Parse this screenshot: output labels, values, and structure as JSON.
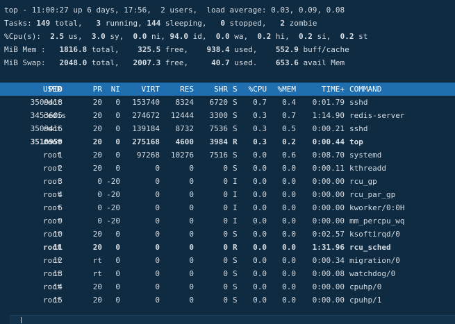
{
  "summary": {
    "uptime_line": "top - 11:00:27 up 6 days, 17:56,  2 users,  load average: 0.03, 0.09, 0.08",
    "tasks": {
      "label": "Tasks:",
      "total": "149",
      "total_label": " total,   ",
      "running": "3",
      "running_label": " running, ",
      "sleeping": "144",
      "sleeping_label": " sleeping,   ",
      "stopped": "0",
      "stopped_label": " stopped,   ",
      "zombie": "2",
      "zombie_label": " zombie"
    },
    "cpu": {
      "label": "%Cpu(s):  ",
      "us": "2.5",
      "us_label": " us,  ",
      "sy": "3.0",
      "sy_label": " sy,  ",
      "ni": "0.0",
      "ni_label": " ni, ",
      "id": "94.0",
      "id_label": " id,  ",
      "wa": "0.0",
      "wa_label": " wa,  ",
      "hi": "0.2",
      "hi_label": " hi,  ",
      "si": "0.2",
      "si_label": " si,  ",
      "st": "0.2",
      "st_label": " st"
    },
    "mem": {
      "label": "MiB Mem :   ",
      "total": "1816.8",
      "total_label": " total,    ",
      "free": "325.5",
      "free_label": " free,    ",
      "used": "938.4",
      "used_label": " used,    ",
      "buff": "552.9",
      "buff_label": " buff/cache"
    },
    "swap": {
      "label": "MiB Swap:   ",
      "total": "2048.0",
      "total_label": " total,   ",
      "free": "2007.3",
      "free_label": " free,     ",
      "used": "40.7",
      "used_label": " used.    ",
      "avail": "653.6",
      "avail_label": " avail Mem"
    }
  },
  "columns": {
    "pid": "PID",
    "user": "USER",
    "pr": "PR",
    "ni": "NI",
    "virt": "VIRT",
    "res": "RES",
    "shr": "SHR",
    "s": "S",
    "cpu": "%CPU",
    "mem": "%MEM",
    "time": "TIME+",
    "command": "COMMAND"
  },
  "processes": [
    {
      "pid": "3509418",
      "user": "root",
      "pr": "20",
      "ni": "0",
      "virt": "153740",
      "res": "8324",
      "shr": "6720",
      "s": "S",
      "cpu": "0.7",
      "mem": "0.4",
      "time": "0:01.79",
      "command": "sshd",
      "bold": false
    },
    {
      "pid": "3453605",
      "user": "redis",
      "pr": "20",
      "ni": "0",
      "virt": "274672",
      "res": "12444",
      "shr": "3300",
      "s": "S",
      "cpu": "0.3",
      "mem": "0.7",
      "time": "1:14.90",
      "command": "redis-server",
      "bold": false
    },
    {
      "pid": "3509416",
      "user": "root",
      "pr": "20",
      "ni": "0",
      "virt": "139184",
      "res": "8732",
      "shr": "7536",
      "s": "S",
      "cpu": "0.3",
      "mem": "0.5",
      "time": "0:00.21",
      "command": "sshd",
      "bold": false
    },
    {
      "pid": "3510959",
      "user": "root",
      "pr": "20",
      "ni": "0",
      "virt": "275168",
      "res": "4600",
      "shr": "3984",
      "s": "R",
      "cpu": "0.3",
      "mem": "0.2",
      "time": "0:00.44",
      "command": "top",
      "bold": true
    },
    {
      "pid": "1",
      "user": "root",
      "pr": "20",
      "ni": "0",
      "virt": "97268",
      "res": "10276",
      "shr": "7516",
      "s": "S",
      "cpu": "0.0",
      "mem": "0.6",
      "time": "0:08.70",
      "command": "systemd",
      "bold": false
    },
    {
      "pid": "2",
      "user": "root",
      "pr": "20",
      "ni": "0",
      "virt": "0",
      "res": "0",
      "shr": "0",
      "s": "S",
      "cpu": "0.0",
      "mem": "0.0",
      "time": "0:00.11",
      "command": "kthreadd",
      "bold": false
    },
    {
      "pid": "3",
      "user": "root",
      "pr": "0",
      "ni": "-20",
      "virt": "0",
      "res": "0",
      "shr": "0",
      "s": "I",
      "cpu": "0.0",
      "mem": "0.0",
      "time": "0:00.00",
      "command": "rcu_gp",
      "bold": false
    },
    {
      "pid": "4",
      "user": "root",
      "pr": "0",
      "ni": "-20",
      "virt": "0",
      "res": "0",
      "shr": "0",
      "s": "I",
      "cpu": "0.0",
      "mem": "0.0",
      "time": "0:00.00",
      "command": "rcu_par_gp",
      "bold": false
    },
    {
      "pid": "6",
      "user": "root",
      "pr": "0",
      "ni": "-20",
      "virt": "0",
      "res": "0",
      "shr": "0",
      "s": "I",
      "cpu": "0.0",
      "mem": "0.0",
      "time": "0:00.00",
      "command": "kworker/0:0H",
      "bold": false
    },
    {
      "pid": "9",
      "user": "root",
      "pr": "0",
      "ni": "-20",
      "virt": "0",
      "res": "0",
      "shr": "0",
      "s": "I",
      "cpu": "0.0",
      "mem": "0.0",
      "time": "0:00.00",
      "command": "mm_percpu_wq",
      "bold": false
    },
    {
      "pid": "10",
      "user": "root",
      "pr": "20",
      "ni": "0",
      "virt": "0",
      "res": "0",
      "shr": "0",
      "s": "S",
      "cpu": "0.0",
      "mem": "0.0",
      "time": "0:02.57",
      "command": "ksoftirqd/0",
      "bold": false
    },
    {
      "pid": "11",
      "user": "root",
      "pr": "20",
      "ni": "0",
      "virt": "0",
      "res": "0",
      "shr": "0",
      "s": "R",
      "cpu": "0.0",
      "mem": "0.0",
      "time": "1:31.96",
      "command": "rcu_sched",
      "bold": true
    },
    {
      "pid": "12",
      "user": "root",
      "pr": "rt",
      "ni": "0",
      "virt": "0",
      "res": "0",
      "shr": "0",
      "s": "S",
      "cpu": "0.0",
      "mem": "0.0",
      "time": "0:00.34",
      "command": "migration/0",
      "bold": false
    },
    {
      "pid": "13",
      "user": "root",
      "pr": "rt",
      "ni": "0",
      "virt": "0",
      "res": "0",
      "shr": "0",
      "s": "S",
      "cpu": "0.0",
      "mem": "0.0",
      "time": "0:00.08",
      "command": "watchdog/0",
      "bold": false
    },
    {
      "pid": "14",
      "user": "root",
      "pr": "20",
      "ni": "0",
      "virt": "0",
      "res": "0",
      "shr": "0",
      "s": "S",
      "cpu": "0.0",
      "mem": "0.0",
      "time": "0:00.00",
      "command": "cpuhp/0",
      "bold": false
    },
    {
      "pid": "15",
      "user": "root",
      "pr": "20",
      "ni": "0",
      "virt": "0",
      "res": "0",
      "shr": "0",
      "s": "S",
      "cpu": "0.0",
      "mem": "0.0",
      "time": "0:00.00",
      "command": "cpuhp/1",
      "bold": false
    }
  ]
}
